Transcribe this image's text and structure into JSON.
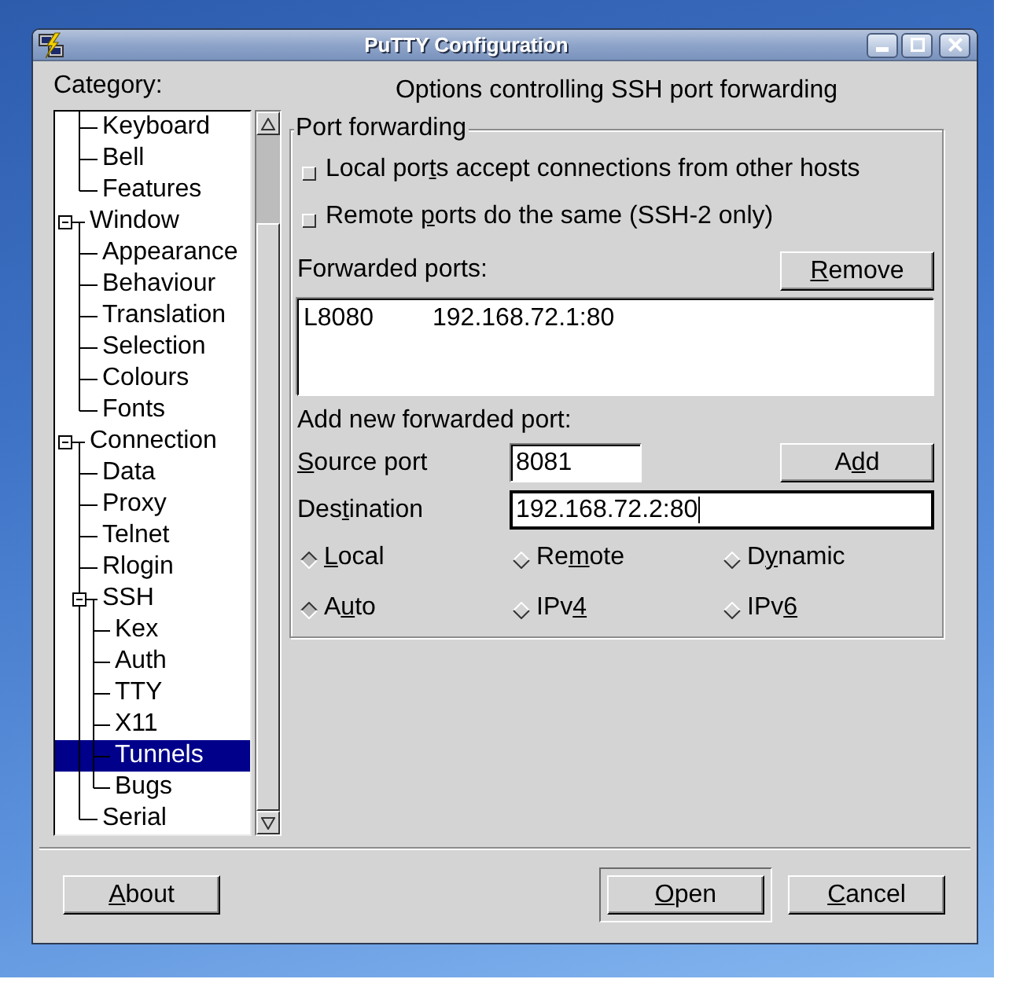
{
  "window": {
    "title": "PuTTY Configuration"
  },
  "category": {
    "label": {
      "pre": "Cate",
      "key": "g",
      "post": "ory:"
    },
    "tree": [
      {
        "children": [
          {
            "label": "Keyboard",
            "selected": false
          },
          {
            "label": "Bell",
            "selected": false
          },
          {
            "label": "Features",
            "selected": false
          }
        ]
      },
      {
        "label": "Window",
        "selected": false,
        "expanded": true,
        "children": [
          {
            "label": "Appearance",
            "selected": false
          },
          {
            "label": "Behaviour",
            "selected": false
          },
          {
            "label": "Translation",
            "selected": false
          },
          {
            "label": "Selection",
            "selected": false
          },
          {
            "label": "Colours",
            "selected": false
          },
          {
            "label": "Fonts",
            "selected": false
          }
        ]
      },
      {
        "label": "Connection",
        "selected": false,
        "expanded": true,
        "children": [
          {
            "label": "Data",
            "selected": false
          },
          {
            "label": "Proxy",
            "selected": false
          },
          {
            "label": "Telnet",
            "selected": false
          },
          {
            "label": "Rlogin",
            "selected": false
          },
          {
            "label": "SSH",
            "selected": false,
            "expanded": true,
            "children": [
              {
                "label": "Kex",
                "selected": false
              },
              {
                "label": "Auth",
                "selected": false
              },
              {
                "label": "TTY",
                "selected": false
              },
              {
                "label": "X11",
                "selected": false
              },
              {
                "label": "Tunnels",
                "selected": true
              },
              {
                "label": "Bugs",
                "selected": false
              }
            ]
          },
          {
            "label": "Serial",
            "selected": false
          }
        ]
      }
    ]
  },
  "panel_title": "Options controlling SSH port forwarding",
  "port_forwarding": {
    "legend": "Port forwarding",
    "options": [
      {
        "label": {
          "pre": "Local por",
          "key": "t",
          "post": "s accept connections from other hosts"
        },
        "checked": false
      },
      {
        "label": {
          "pre": "Remote ",
          "key": "p",
          "post": "orts do the same (SSH-2 only)"
        },
        "checked": false
      }
    ]
  },
  "forwarded_ports": {
    "label": "Forwarded ports:",
    "remove_button": {
      "key": "R",
      "post": "emove"
    },
    "rows": [
      {
        "source": "L8080",
        "destination": "192.168.72.1:80",
        "selected": false
      }
    ]
  },
  "add_new": {
    "label": "Add new forwarded port:",
    "source_port": {
      "label": {
        "key": "S",
        "post": "ource port"
      },
      "value": "8081",
      "focused": false
    },
    "add_button": {
      "pre": "A",
      "key": "d",
      "post": "d"
    },
    "destination": {
      "label": {
        "pre": "Des",
        "key": "t",
        "post": "ination"
      },
      "value": "192.168.72.2:80",
      "focused": true
    },
    "direction": [
      {
        "label": {
          "key": "L",
          "post": "ocal"
        },
        "selected": true
      },
      {
        "label": {
          "pre": "Re",
          "key": "m",
          "post": "ote"
        },
        "selected": false
      },
      {
        "label": {
          "pre": "D",
          "key": "y",
          "post": "namic"
        },
        "selected": false
      }
    ],
    "protocol": [
      {
        "label": {
          "pre": "A",
          "key": "u",
          "post": "to"
        },
        "selected": true
      },
      {
        "label": {
          "pre": "IPv",
          "key": "4"
        },
        "selected": false
      },
      {
        "label": {
          "pre": "IPv",
          "key": "6"
        },
        "selected": false
      }
    ]
  },
  "buttons": [
    {
      "label": {
        "key": "A",
        "post": "bout"
      },
      "default": false
    },
    {
      "label": {
        "key": "O",
        "post": "pen"
      },
      "default": true
    },
    {
      "label": {
        "key": "C",
        "post": "ancel"
      },
      "default": false
    }
  ]
}
